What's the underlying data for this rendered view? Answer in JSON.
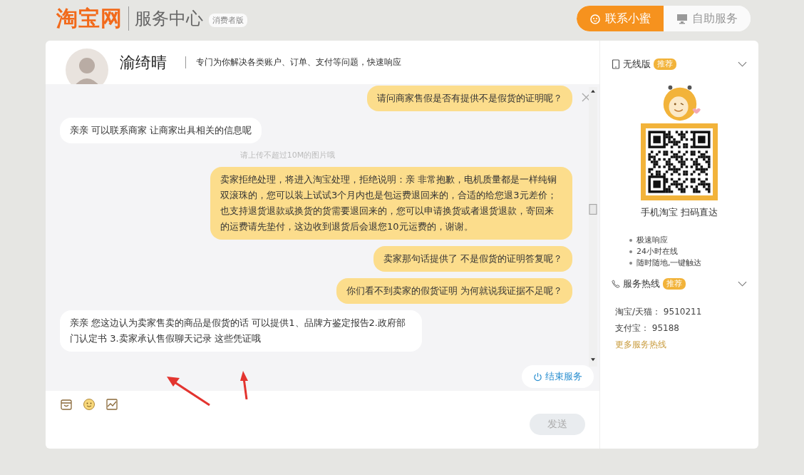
{
  "header": {
    "logo": "淘宝网",
    "title": "服务中心",
    "edition": "消费者版",
    "tabs": [
      {
        "label": "联系小蜜",
        "selected": true
      },
      {
        "label": "自助服务",
        "selected": false
      }
    ]
  },
  "agent": {
    "name": "渝绮晴",
    "slogan": "专门为你解决各类账户、订单、支付等问题，快速响应"
  },
  "messages": [
    {
      "kind": "me",
      "text": "请问商家售假是否有提供不是假货的证明呢？"
    },
    {
      "kind": "agent",
      "text": "亲亲 可以联系商家 让商家出具相关的信息呢"
    },
    {
      "kind": "system",
      "text": "请上传不超过10M的图片哦"
    },
    {
      "kind": "me",
      "text": "卖家拒绝处理，将进入淘宝处理，拒绝说明：亲 非常抱歉，电机质量都是一样纯铜双滚珠的，您可以装上试试3个月内也是包运费退回来的，合适的给您退3元差价；也支持退货退款或换货的货需要退回来的，您可以申请换货或者退货退款，寄回来的运费请先垫付，这边收到退货后会退您10元运费的，谢谢。"
    },
    {
      "kind": "me",
      "text": "卖家那句话提供了 不是假货的证明答复呢？"
    },
    {
      "kind": "me",
      "text": "你们看不到卖家的假货证明 为何就说我证据不足呢？"
    },
    {
      "kind": "agent",
      "text": "亲亲 您这边认为卖家售卖的商品是假货的话 可以提供1、品牌方鉴定报告2.政府部门认定书 3.卖家承认售假聊天记录 这些凭证哦"
    }
  ],
  "end_button": "结束服务",
  "send_button": "发送",
  "sidebar": {
    "mobile": {
      "title": "无线版",
      "badge": "推荐",
      "expanded": true,
      "caption": "手机淘宝 扫码直达",
      "features": [
        "极速响应",
        "24小时在线",
        "随时随地,一键触达"
      ]
    },
    "hotline": {
      "title": "服务热线",
      "badge": "推荐",
      "expanded": true,
      "lines": [
        "淘宝/天猫： 9510211",
        "支付宝： 95188"
      ],
      "more_link": "更多服务热线"
    }
  }
}
